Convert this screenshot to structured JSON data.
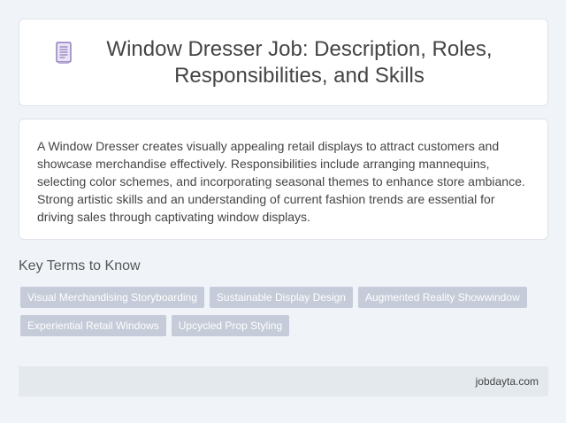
{
  "header": {
    "icon": "document-icon",
    "title": "Window Dresser Job: Description, Roles, Responsibilities, and Skills"
  },
  "description": "A Window Dresser creates visually appealing retail displays to attract customers and showcase merchandise effectively. Responsibilities include arranging mannequins, selecting color schemes, and incorporating seasonal themes to enhance store ambiance. Strong artistic skills and an understanding of current fashion trends are essential for driving sales through captivating window displays.",
  "key_terms": {
    "heading": "Key Terms to Know",
    "tags": [
      "Visual Merchandising Storyboarding",
      "Sustainable Display Design",
      "Augmented Reality Showwindow",
      "Experiential Retail Windows",
      "Upcycled Prop Styling"
    ]
  },
  "footer": {
    "source": "jobdayta.com"
  },
  "colors": {
    "background": "#f0f4f8",
    "card": "#ffffff",
    "tag": "#c5cbd8",
    "footer": "#e3e9ed",
    "icon_accent": "#8b7bb8"
  }
}
